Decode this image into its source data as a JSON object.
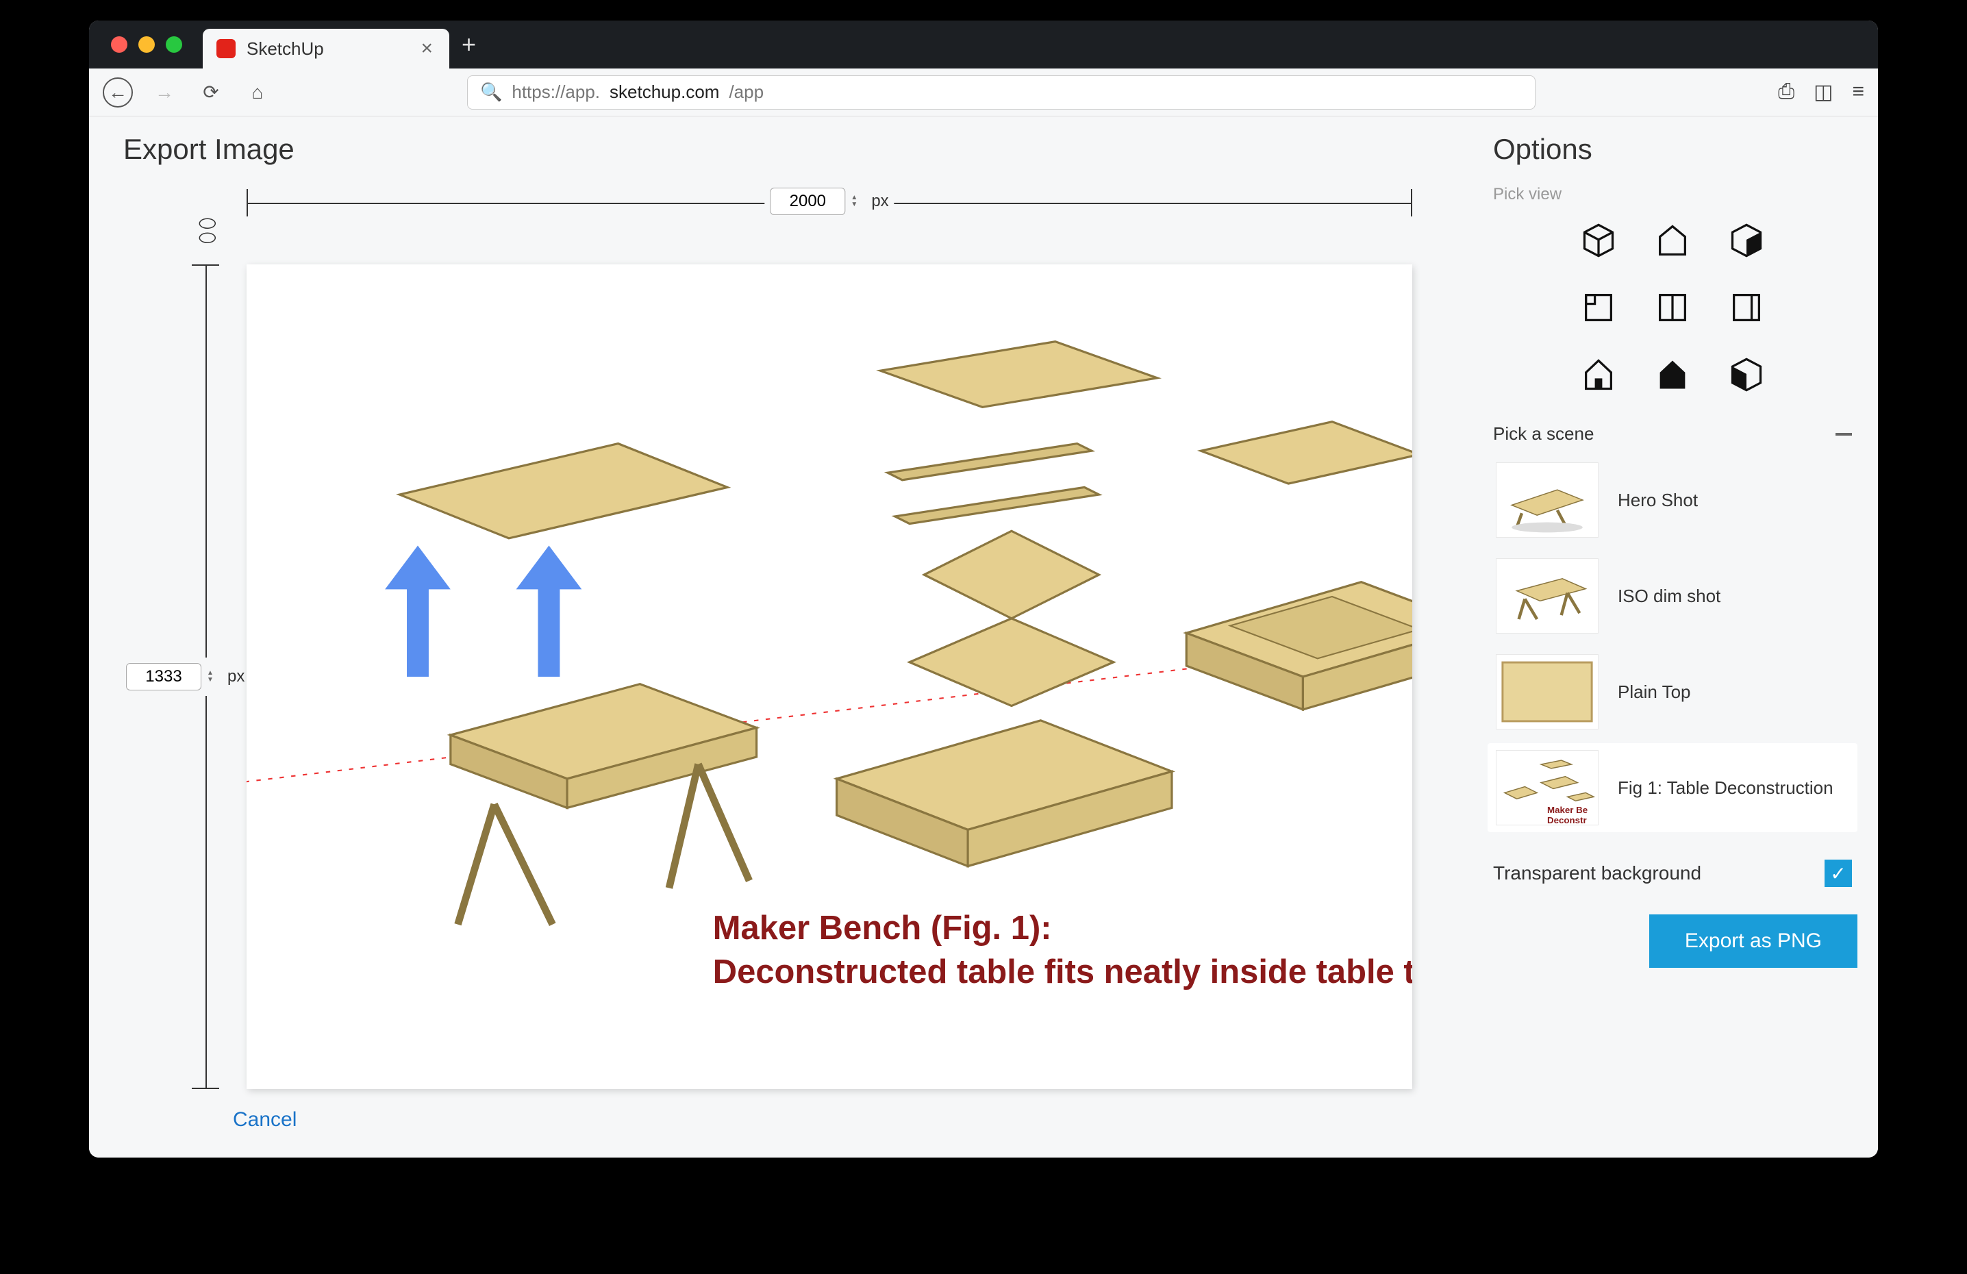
{
  "browser": {
    "tab_title": "SketchUp",
    "url_display_pre": "https://app.",
    "url_display_host": "sketchup.com",
    "url_display_post": "/app"
  },
  "header": {
    "title": "Export Image"
  },
  "dimensions": {
    "width_value": "2000",
    "width_unit": "px",
    "height_value": "1333",
    "height_unit": "px"
  },
  "preview": {
    "caption_line1": "Maker Bench (Fig. 1):",
    "caption_line2": "Deconstructed table fits neatly inside table top"
  },
  "options": {
    "title": "Options",
    "pick_view_label": "Pick view",
    "views": [
      "iso-view",
      "front-view",
      "right-view",
      "top-view",
      "back-view",
      "left-view",
      "bottom-view",
      "perspective-view",
      "two-point-view"
    ],
    "pick_scene_label": "Pick a scene",
    "scenes": [
      {
        "label": "Hero Shot"
      },
      {
        "label": "ISO dim shot"
      },
      {
        "label": "Plain Top"
      },
      {
        "label": "Fig 1: Table Deconstruction",
        "selected": true
      }
    ],
    "transparent_label": "Transparent background",
    "transparent_checked": true,
    "export_button": "Export as PNG"
  },
  "footer": {
    "cancel": "Cancel"
  }
}
